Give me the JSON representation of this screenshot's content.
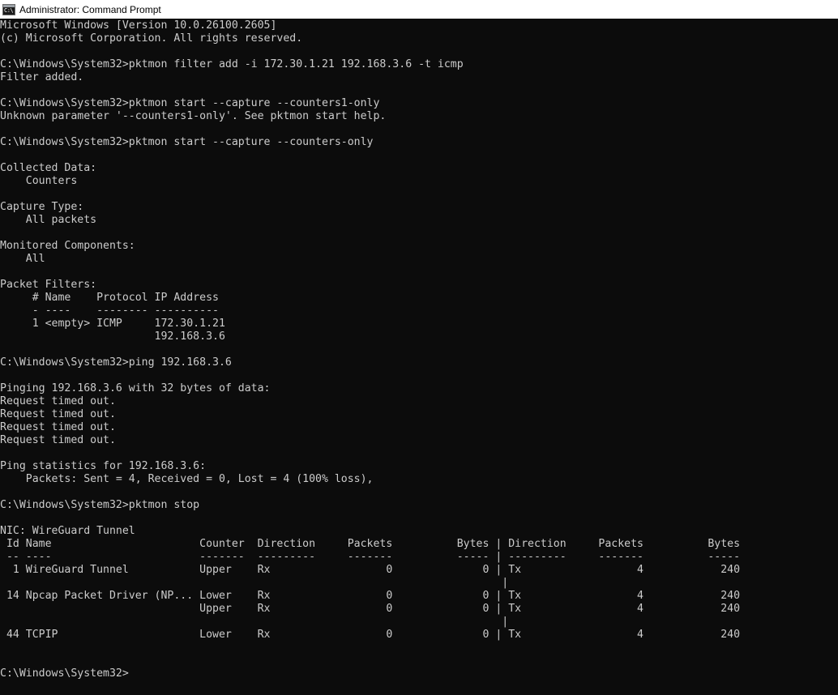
{
  "window": {
    "title": "Administrator: Command Prompt",
    "icon": "command-prompt-icon",
    "icon_glyph": "C:\\"
  },
  "console": {
    "lines": [
      "Microsoft Windows [Version 10.0.26100.2605]",
      "(c) Microsoft Corporation. All rights reserved.",
      "",
      "C:\\Windows\\System32>pktmon filter add -i 172.30.1.21 192.168.3.6 -t icmp",
      "Filter added.",
      "",
      "C:\\Windows\\System32>pktmon start --capture --counters1-only",
      "Unknown parameter '--counters1-only'. See pktmon start help.",
      "",
      "C:\\Windows\\System32>pktmon start --capture --counters-only",
      "",
      "Collected Data:",
      "    Counters",
      "",
      "Capture Type:",
      "    All packets",
      "",
      "Monitored Components:",
      "    All",
      "",
      "Packet Filters:",
      "     # Name    Protocol IP Address",
      "     - ----    -------- ----------",
      "     1 <empty> ICMP     172.30.1.21",
      "                        192.168.3.6",
      "",
      "C:\\Windows\\System32>ping 192.168.3.6",
      "",
      "Pinging 192.168.3.6 with 32 bytes of data:",
      "Request timed out.",
      "Request timed out.",
      "Request timed out.",
      "Request timed out.",
      "",
      "Ping statistics for 192.168.3.6:",
      "    Packets: Sent = 4, Received = 0, Lost = 4 (100% loss),",
      "",
      "C:\\Windows\\System32>pktmon stop",
      "",
      "NIC: WireGuard Tunnel",
      " Id Name                       Counter  Direction     Packets          Bytes | Direction     Packets          Bytes",
      " -- ----                       -------  ---------     -------          ----- | ---------     -------          -----",
      "  1 WireGuard Tunnel           Upper    Rx                  0              0 | Tx                  4            240",
      "                                                                              |",
      " 14 Npcap Packet Driver (NP... Lower    Rx                  0              0 | Tx                  4            240",
      "                               Upper    Rx                  0              0 | Tx                  4            240",
      "                                                                              |",
      " 44 TCPIP                      Lower    Rx                  0              0 | Tx                  4            240",
      "",
      "",
      "C:\\Windows\\System32>"
    ]
  }
}
